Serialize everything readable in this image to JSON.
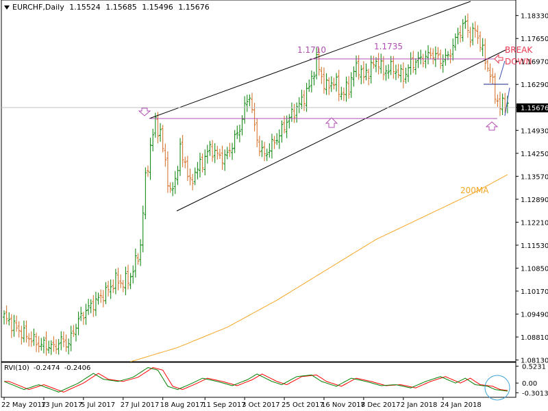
{
  "header": {
    "symbol": "EURCHF,Daily",
    "open": "1.15524",
    "high": "1.15685",
    "low": "1.15496",
    "close": "1.15676"
  },
  "rvi_header": {
    "name": "RVI(10)",
    "value1": "-0.2474",
    "value2": "-0.2406"
  },
  "colors": {
    "bull": "#008000",
    "bear": "#d2691e",
    "ma": "#f5a623",
    "purple": "#b04cb0",
    "trend": "#000000",
    "break": "#e8364f",
    "rvi_main": "#008000",
    "rvi_signal": "#ff0000",
    "circle": "#3aa3d8"
  },
  "chart_data": [
    {
      "type": "candlestick",
      "title": "EURCHF,Daily",
      "y_ticks": [
        "1.18330",
        "1.17650",
        "1.16970",
        "1.16290",
        "1.15610",
        "1.14930",
        "1.14250",
        "1.13570",
        "1.12890",
        "1.12210",
        "1.11530",
        "1.10850",
        "1.10170",
        "1.09490",
        "1.08810",
        "1.08130"
      ],
      "ylim": [
        1.0808,
        1.1879
      ],
      "x_ticks": [
        "22 May 2017",
        "13 Jun 2017",
        "5 Jul 2017",
        "27 Jul 2017",
        "18 Aug 2017",
        "11 Sep 2017",
        "3 Oct 2017",
        "25 Oct 2017",
        "16 Nov 2017",
        "8 Dec 2017",
        "2 Jan 2018",
        "24 Jan 2018"
      ],
      "current_price": "1.15676",
      "annotations": [
        {
          "text": "1.1710",
          "price": 1.171
        },
        {
          "text": "1.1735",
          "price": 1.1735
        },
        {
          "text": "BREAK",
          "price": 1.1722
        },
        {
          "text": "DOWN",
          "price": 1.1696
        },
        {
          "text": "200MA",
          "price": 1.133
        }
      ],
      "levels": [
        {
          "name": "resistance",
          "price": 1.171
        },
        {
          "name": "support",
          "price": 1.154
        }
      ],
      "series": [
        {
          "name": "price",
          "anchors": [
            [
              0,
              1.094
            ],
            [
              6,
              1.09
            ],
            [
              10,
              1.088
            ],
            [
              14,
              1.086
            ],
            [
              18,
              1.0855
            ],
            [
              20,
              1.085
            ],
            [
              23,
              1.087
            ],
            [
              26,
              1.086
            ],
            [
              28,
              1.09
            ],
            [
              30,
              1.093
            ],
            [
              33,
              1.096
            ],
            [
              36,
              1.098
            ],
            [
              39,
              1.1
            ],
            [
              42,
              1.102
            ],
            [
              45,
              1.105
            ],
            [
              48,
              1.104
            ],
            [
              51,
              1.106
            ],
            [
              53,
              1.11
            ],
            [
              55,
              1.115
            ],
            [
              57,
              1.135
            ],
            [
              59,
              1.144
            ],
            [
              61,
              1.152
            ],
            [
              63,
              1.148
            ],
            [
              65,
              1.14
            ],
            [
              67,
              1.13
            ],
            [
              69,
              1.135
            ],
            [
              71,
              1.143
            ],
            [
              73,
              1.14
            ],
            [
              75,
              1.133
            ],
            [
              77,
              1.137
            ],
            [
              80,
              1.14
            ],
            [
              83,
              1.144
            ],
            [
              86,
              1.142
            ],
            [
              89,
              1.141
            ],
            [
              92,
              1.145
            ],
            [
              95,
              1.15
            ],
            [
              97,
              1.156
            ],
            [
              99,
              1.16
            ],
            [
              101,
              1.15
            ],
            [
              103,
              1.144
            ],
            [
              105,
              1.142
            ],
            [
              108,
              1.145
            ],
            [
              111,
              1.148
            ],
            [
              114,
              1.152
            ],
            [
              117,
              1.155
            ],
            [
              120,
              1.158
            ],
            [
              123,
              1.162
            ],
            [
              126,
              1.17
            ],
            [
              128,
              1.165
            ],
            [
              130,
              1.162
            ],
            [
              133,
              1.164
            ],
            [
              136,
              1.16
            ],
            [
              139,
              1.162
            ],
            [
              141,
              1.167
            ],
            [
              143,
              1.168
            ],
            [
              145,
              1.165
            ],
            [
              148,
              1.168
            ],
            [
              151,
              1.17
            ],
            [
              153,
              1.166
            ],
            [
              155,
              1.168
            ],
            [
              158,
              1.167
            ],
            [
              161,
              1.165
            ],
            [
              164,
              1.169
            ],
            [
              167,
              1.17
            ],
            [
              170,
              1.171
            ],
            [
              173,
              1.172
            ],
            [
              176,
              1.17
            ],
            [
              179,
              1.171
            ],
            [
              182,
              1.176
            ],
            [
              184,
              1.179
            ],
            [
              186,
              1.181
            ],
            [
              188,
              1.177
            ],
            [
              190,
              1.179
            ],
            [
              192,
              1.175
            ],
            [
              194,
              1.17
            ],
            [
              196,
              1.166
            ],
            [
              198,
              1.16
            ],
            [
              200,
              1.156
            ],
            [
              202,
              1.158
            ],
            [
              203,
              1.1568
            ]
          ]
        },
        {
          "name": "200MA",
          "anchors": [
            [
              51,
              1.0808
            ],
            [
              70,
              1.085
            ],
            [
              90,
              1.091
            ],
            [
              110,
              1.099
            ],
            [
              130,
              1.108
            ],
            [
              150,
              1.117
            ],
            [
              170,
              1.124
            ],
            [
              190,
              1.131
            ],
            [
              203,
              1.1362
            ]
          ]
        }
      ]
    },
    {
      "type": "line",
      "title": "RVI(10)",
      "y_ticks": [
        "0.5231",
        "0.00",
        "-0.3013"
      ],
      "ylim": [
        -0.42,
        0.62
      ],
      "series": [
        {
          "name": "RVI",
          "anchors": [
            [
              0,
              0.05
            ],
            [
              8,
              -0.2
            ],
            [
              14,
              -0.05
            ],
            [
              22,
              -0.28
            ],
            [
              30,
              0.0
            ],
            [
              36,
              0.3
            ],
            [
              40,
              0.12
            ],
            [
              46,
              0.05
            ],
            [
              52,
              0.18
            ],
            [
              58,
              0.48
            ],
            [
              62,
              0.4
            ],
            [
              66,
              -0.1
            ],
            [
              70,
              -0.2
            ],
            [
              76,
              0.0
            ],
            [
              80,
              0.15
            ],
            [
              86,
              0.05
            ],
            [
              92,
              -0.08
            ],
            [
              98,
              0.1
            ],
            [
              102,
              0.28
            ],
            [
              108,
              0.05
            ],
            [
              112,
              -0.05
            ],
            [
              118,
              0.2
            ],
            [
              124,
              0.25
            ],
            [
              128,
              0.05
            ],
            [
              134,
              -0.1
            ],
            [
              140,
              0.15
            ],
            [
              146,
              0.05
            ],
            [
              152,
              -0.08
            ],
            [
              158,
              -0.05
            ],
            [
              164,
              -0.15
            ],
            [
              170,
              0.05
            ],
            [
              176,
              0.2
            ],
            [
              182,
              0.0
            ],
            [
              186,
              0.15
            ],
            [
              190,
              -0.05
            ],
            [
              195,
              -0.1
            ],
            [
              198,
              -0.2
            ],
            [
              203,
              -0.25
            ]
          ]
        }
      ]
    }
  ]
}
